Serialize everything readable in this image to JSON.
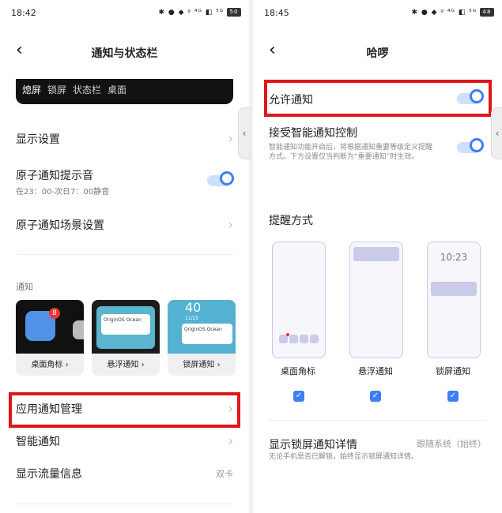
{
  "left": {
    "status_time": "18:42",
    "status_icons": "✱ ● ◆ ᵍ ⁴ᴳ ◧ ⁵ᴳ",
    "battery": "50",
    "title": "通知与状态栏",
    "tabs": [
      "熄屏",
      "锁屏",
      "状态栏",
      "桌面"
    ],
    "display_settings": "显示设置",
    "atom_tone": "原子通知提示音",
    "atom_tone_sub": "在23：00-次日7：00静音",
    "atom_scene": "原子通知场景设置",
    "section_notify": "通知",
    "cards": [
      {
        "label": "桌面角标",
        "badge": "8"
      },
      {
        "label": "悬浮通知",
        "text": "OriginOS Ocean"
      },
      {
        "label": "锁屏通知",
        "text": "40",
        "date": "11/25"
      }
    ],
    "app_notify": "应用通知管理",
    "smart_notify": "智能通知",
    "traffic": "显示流量信息",
    "traffic_value": "双卡"
  },
  "right": {
    "status_time": "18:45",
    "status_icons": "✱ ● ◆ ᵍ ⁴ᴳ ◧ ⁵ᴳ",
    "battery": "48",
    "title": "哈啰",
    "allow": "允许通知",
    "smart_ctrl": "接受智能通知控制",
    "smart_desc": "智能通知功能开启后，将根据通知重要等级定义提醒方式。下方设置仅当判断为“重要通知”时生效。",
    "section_remind": "提醒方式",
    "lock_time": "10:23",
    "phones": [
      "桌面角标",
      "悬浮通知",
      "锁屏通知"
    ],
    "lock_detail": "显示锁屏通知详情",
    "lock_detail_value": "跟随系统（始终）",
    "lock_detail_sub": "无论手机是否已解锁，始终显示锁屏通知详情。"
  },
  "colors": {
    "accent": "#3d7ff5",
    "highlight": "#e0151c"
  }
}
